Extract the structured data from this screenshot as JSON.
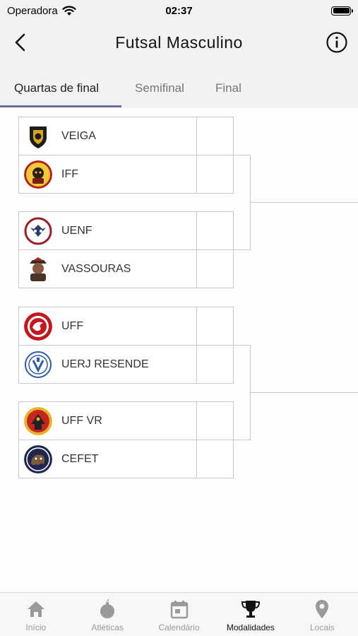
{
  "status_bar": {
    "carrier": "Operadora",
    "time": "02:37"
  },
  "header": {
    "title": "Futsal Masculino"
  },
  "tabs": [
    {
      "label": "Quartas de final",
      "active": true
    },
    {
      "label": "Semifinal",
      "active": false
    },
    {
      "label": "Final",
      "active": false
    }
  ],
  "bracket": {
    "matches": [
      {
        "home": "VEIGA",
        "away": "IFF"
      },
      {
        "home": "UENF",
        "away": "VASSOURAS"
      },
      {
        "home": "UFF",
        "away": "UERJ RESENDE"
      },
      {
        "home": "UFF VR",
        "away": "CEFET"
      }
    ]
  },
  "tab_bar": [
    {
      "label": "Início",
      "icon": "home-icon",
      "active": false
    },
    {
      "label": "Atléticas",
      "icon": "bomb-icon",
      "active": false
    },
    {
      "label": "Calendário",
      "icon": "calendar-icon",
      "active": false
    },
    {
      "label": "Modalidades",
      "icon": "trophy-icon",
      "active": true
    },
    {
      "label": "Locais",
      "icon": "location-pin-icon",
      "active": false
    }
  ],
  "colors": {
    "tab_accent": "#6f6e96",
    "active_text": "#111111",
    "inactive_text": "#999999"
  }
}
